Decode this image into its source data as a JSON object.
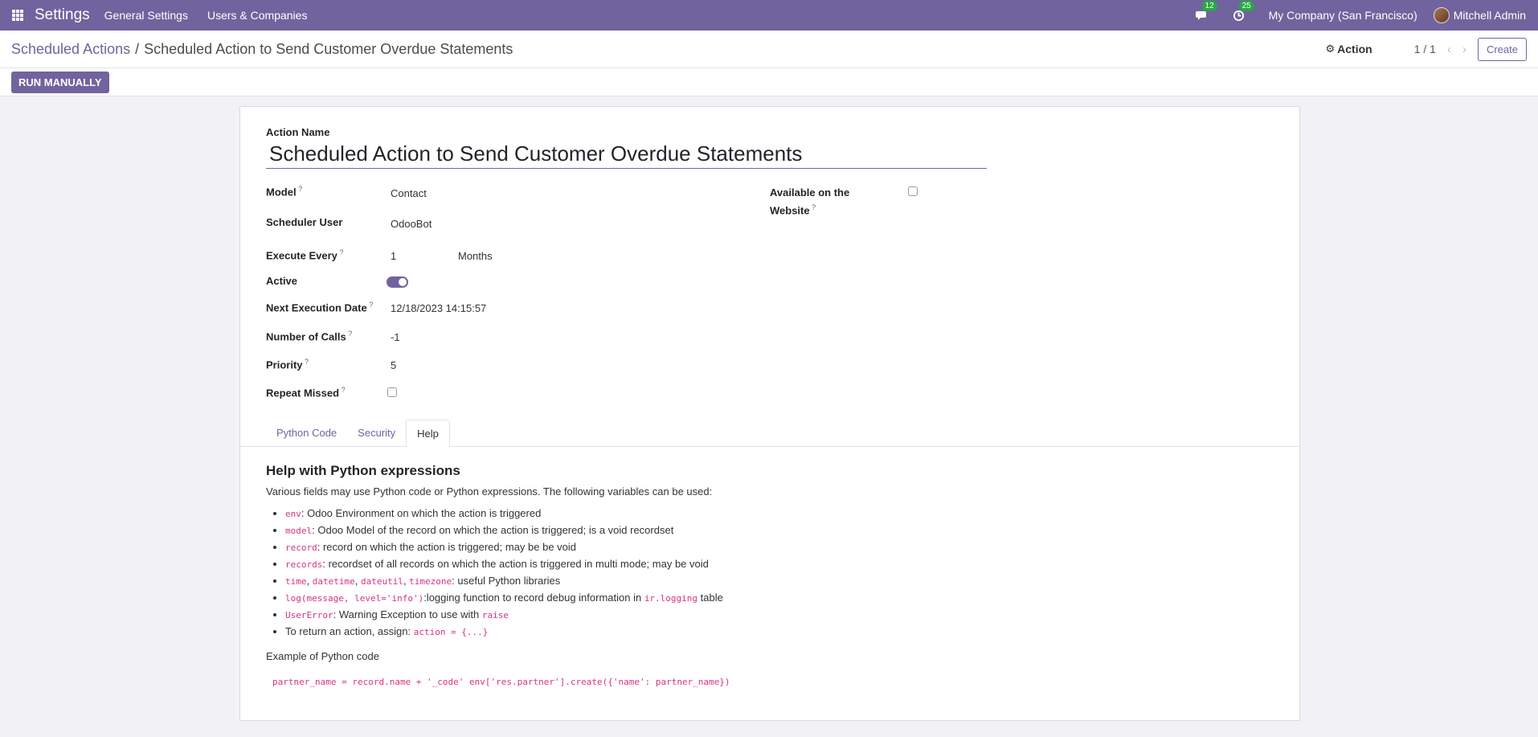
{
  "navbar": {
    "brand": "Settings",
    "links": [
      "General Settings",
      "Users & Companies"
    ],
    "messages_count": "12",
    "activities_count": "25",
    "company": "My Company (San Francisco)",
    "user": "Mitchell Admin"
  },
  "control": {
    "breadcrumb_parent": "Scheduled Actions",
    "breadcrumb_sep": "/",
    "breadcrumb_current": "Scheduled Action to Send Customer Overdue Statements",
    "action_label": "Action",
    "pager": "1 / 1",
    "create_label": "Create"
  },
  "statusbar": {
    "run_label": "RUN MANUALLY"
  },
  "form": {
    "action_name_label": "Action Name",
    "action_name": "Scheduled Action to Send Customer Overdue Statements",
    "fields": {
      "model_label": "Model",
      "model": "Contact",
      "scheduler_user_label": "Scheduler User",
      "scheduler_user": "OdooBot",
      "execute_every_label": "Execute Every",
      "execute_every": "1",
      "execute_unit": "Months",
      "active_label": "Active",
      "active": true,
      "next_exec_label": "Next Execution Date",
      "next_exec": "12/18/2023 14:15:57",
      "num_calls_label": "Number of Calls",
      "num_calls": "-1",
      "priority_label": "Priority",
      "priority": "5",
      "repeat_missed_label": "Repeat Missed",
      "repeat_missed": false,
      "website_label_1": "Available on the",
      "website_label_2": "Website",
      "website": false
    },
    "tabs": [
      "Python Code",
      "Security",
      "Help"
    ],
    "help": {
      "title": "Help with Python expressions",
      "intro": "Various fields may use Python code or Python expressions. The following variables can be used:",
      "items": {
        "env_code": "env",
        "env_text": ": Odoo Environment on which the action is triggered",
        "model_code": "model",
        "model_text": ": Odoo Model of the record on which the action is triggered; is a void recordset",
        "record_code": "record",
        "record_text": ": record on which the action is triggered; may be be void",
        "records_code": "records",
        "records_text": ": recordset of all records on which the action is triggered in multi mode; may be void",
        "time_code": "time",
        "datetime_code": "datetime",
        "dateutil_code": "dateutil",
        "timezone_code": "timezone",
        "libs_text": ": useful Python libraries",
        "log_code": "log(message, level='info')",
        "log_text": ":logging function to record debug information in ",
        "log_table_code": "ir.logging",
        "log_table_text": " table",
        "usererror_code": "UserError",
        "usererror_text": ": Warning Exception to use with ",
        "raise_code": "raise",
        "return_text": "To return an action, assign: ",
        "return_code": "action = {...}"
      },
      "example_label": "Example of Python code",
      "example_code": "partner_name = record.name + '_code' env['res.partner'].create({'name': partner_name})"
    }
  }
}
